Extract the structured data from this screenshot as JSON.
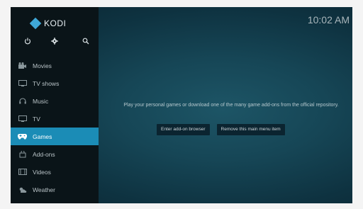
{
  "app": {
    "logo_text": "KODI"
  },
  "clock": "10:02 AM",
  "controls": [
    {
      "icon": "power-icon"
    },
    {
      "icon": "gear-icon"
    },
    {
      "icon": "search-icon"
    }
  ],
  "sidebar": {
    "items": [
      {
        "label": "Movies",
        "icon": "movies-icon"
      },
      {
        "label": "TV shows",
        "icon": "tv-shows-icon"
      },
      {
        "label": "Music",
        "icon": "headphones-icon"
      },
      {
        "label": "TV",
        "icon": "tv-icon"
      },
      {
        "label": "Games",
        "icon": "gamepad-icon",
        "active": true
      },
      {
        "label": "Add-ons",
        "icon": "addons-icon"
      },
      {
        "label": "Videos",
        "icon": "videos-icon"
      },
      {
        "label": "Weather",
        "icon": "weather-icon"
      }
    ]
  },
  "main": {
    "message": "Play your personal games or download one of the many game add-ons from the official repository.",
    "buttons": {
      "addon_browser": "Enter add-on browser",
      "remove_item": "Remove this main menu item"
    }
  },
  "colors": {
    "accent": "#1b8cb6",
    "background": "#164656",
    "sidebar": "#0a1418"
  }
}
